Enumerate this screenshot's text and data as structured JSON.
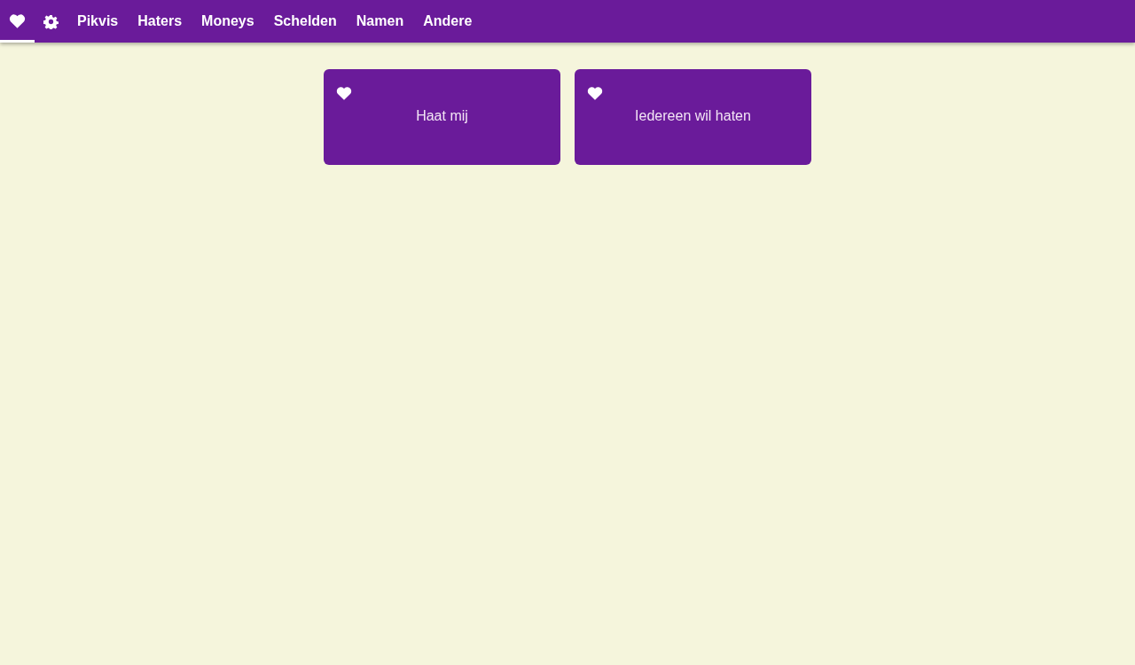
{
  "tabs": [
    {
      "kind": "heart",
      "selected": true
    },
    {
      "kind": "gear",
      "selected": false
    },
    {
      "kind": "text",
      "label": "Pikvis",
      "selected": false
    },
    {
      "kind": "text",
      "label": "Haters",
      "selected": false
    },
    {
      "kind": "text",
      "label": "Moneys",
      "selected": false
    },
    {
      "kind": "text",
      "label": "Schelden",
      "selected": false
    },
    {
      "kind": "text",
      "label": "Namen",
      "selected": false
    },
    {
      "kind": "text",
      "label": "Andere",
      "selected": false
    }
  ],
  "cards": [
    {
      "label": "Haat mij",
      "favorite": true
    },
    {
      "label": "Iedereen wil haten",
      "favorite": true
    }
  ]
}
